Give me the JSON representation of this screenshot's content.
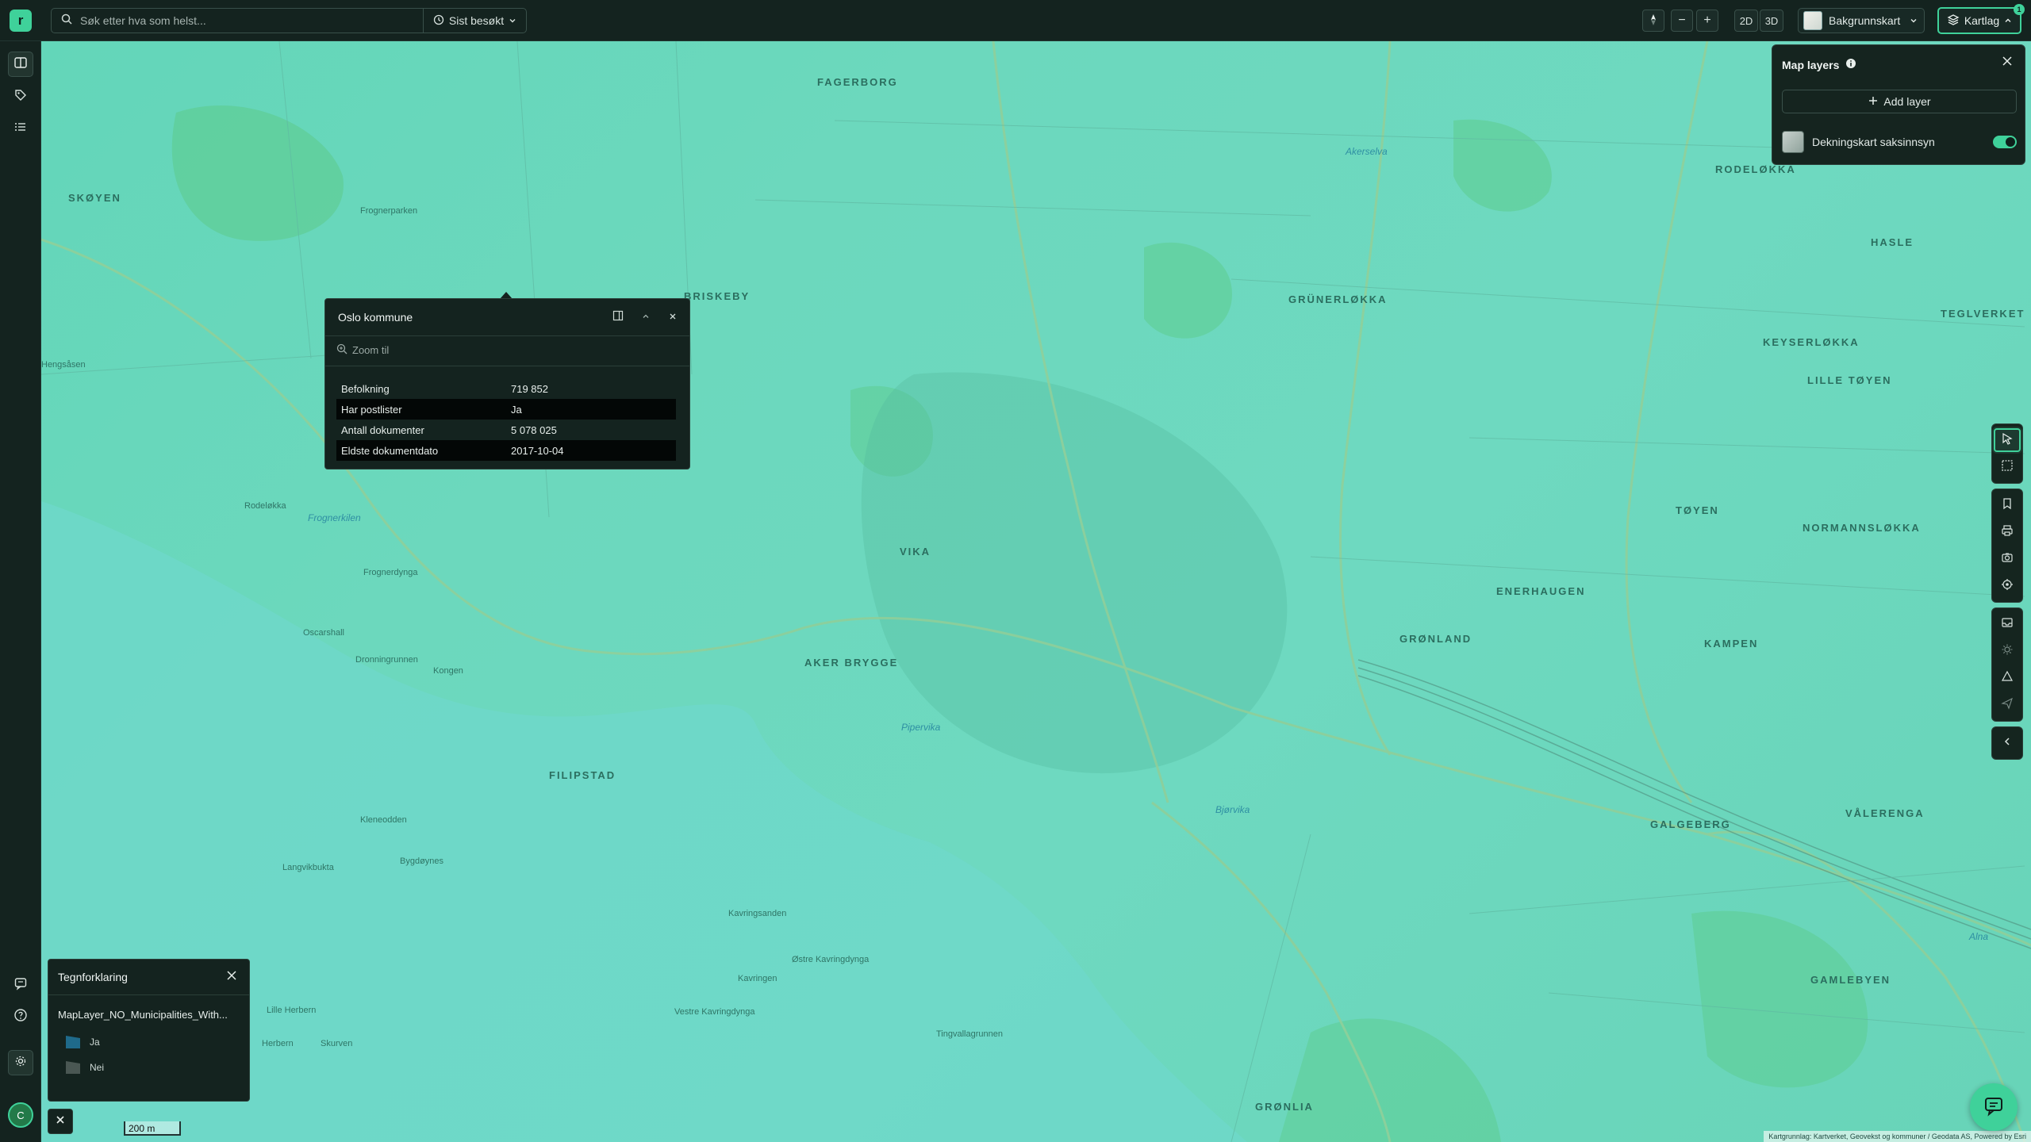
{
  "app": {
    "logo_letter": "r"
  },
  "search": {
    "placeholder": "Søk etter hva som helst...",
    "recent_label": "Sist besøkt"
  },
  "view": {
    "mode_2d": "2D",
    "mode_3d": "3D",
    "zoom_out": "−",
    "zoom_in": "+"
  },
  "basemap": {
    "label": "Bakgrunnskart"
  },
  "layers_button": {
    "label": "Kartlag",
    "badge": "1"
  },
  "colors": {
    "accent": "#3fd19a",
    "map_fill": "#6ad8bd",
    "panel_bg": "#14231f"
  },
  "layers_panel": {
    "title": "Map layers",
    "add_label": "Add layer",
    "layers": [
      {
        "name": "Dekningskart saksinnsyn",
        "enabled": true
      }
    ]
  },
  "popup": {
    "title": "Oslo kommune",
    "zoom_label": "Zoom til",
    "rows": [
      {
        "key": "Befolkning",
        "value": "719 852"
      },
      {
        "key": "Har postlister",
        "value": "Ja"
      },
      {
        "key": "Antall dokumenter",
        "value": "5 078 025"
      },
      {
        "key": "Eldste dokumentdato",
        "value": "2017-10-04"
      }
    ]
  },
  "legend": {
    "title": "Tegnforklaring",
    "layer_name": "MapLayer_NO_Municipalities_With...",
    "items": [
      {
        "label": "Ja",
        "color": "#1f6a8a"
      },
      {
        "label": "Nei",
        "color": "#4a5753"
      }
    ]
  },
  "map": {
    "scale": "200 m",
    "attribution": "Kartgrunnlag: Kartverket, Geovekst og kommuner / Geodata AS, Powered by Esri",
    "labels": [
      {
        "text": "FAGERBORG",
        "cls": ""
      },
      {
        "text": "SKØYEN",
        "cls": ""
      },
      {
        "text": "BRISKEBY",
        "cls": ""
      },
      {
        "text": "RODELØKKA",
        "cls": ""
      },
      {
        "text": "GRÜNERLØKKA",
        "cls": ""
      },
      {
        "text": "HASLE",
        "cls": ""
      },
      {
        "text": "KEYSERLØKKA",
        "cls": ""
      },
      {
        "text": "LILLE TØYEN",
        "cls": ""
      },
      {
        "text": "TEGLVERKET",
        "cls": ""
      },
      {
        "text": "TØYEN",
        "cls": ""
      },
      {
        "text": "NORMANNSLØKKA",
        "cls": ""
      },
      {
        "text": "VIKA",
        "cls": ""
      },
      {
        "text": "AKER BRYGGE",
        "cls": ""
      },
      {
        "text": "GRØNLAND",
        "cls": ""
      },
      {
        "text": "ENERHAUGEN",
        "cls": ""
      },
      {
        "text": "KAMPEN",
        "cls": ""
      },
      {
        "text": "FILIPSTAD",
        "cls": ""
      },
      {
        "text": "GALGEBERG",
        "cls": ""
      },
      {
        "text": "VÅLERENGA",
        "cls": ""
      },
      {
        "text": "GAMLEBYEN",
        "cls": ""
      },
      {
        "text": "GRØNLIA",
        "cls": ""
      },
      {
        "text": "Frognerparken",
        "cls": "small"
      },
      {
        "text": "Frognerkilen",
        "cls": "water"
      },
      {
        "text": "Akerselva",
        "cls": "water"
      },
      {
        "text": "Pipervika",
        "cls": "water"
      },
      {
        "text": "Bjørvika",
        "cls": "water"
      },
      {
        "text": "Frognerdynga",
        "cls": "small"
      },
      {
        "text": "Dronningrunnen",
        "cls": "small"
      },
      {
        "text": "Kavringsanden",
        "cls": "small"
      },
      {
        "text": "Østre Kavringdynga",
        "cls": "small"
      },
      {
        "text": "Tingvallagrunnen",
        "cls": "small"
      },
      {
        "text": "Kongen",
        "cls": "small"
      },
      {
        "text": "Bygdøynes",
        "cls": "small"
      },
      {
        "text": "Oscarshall",
        "cls": "small"
      },
      {
        "text": "Rodeløkka",
        "cls": "small"
      },
      {
        "text": "Hengsåsen",
        "cls": "small"
      },
      {
        "text": "Langvikbukta",
        "cls": "small"
      },
      {
        "text": "Kleneodden",
        "cls": "small"
      },
      {
        "text": "Lille Herbern",
        "cls": "small"
      },
      {
        "text": "Herbern",
        "cls": "small"
      },
      {
        "text": "Skurven",
        "cls": "small"
      },
      {
        "text": "Kavringen",
        "cls": "small"
      },
      {
        "text": "Vestre Kavringdynga",
        "cls": "small"
      },
      {
        "text": "Alna",
        "cls": "water"
      }
    ]
  }
}
